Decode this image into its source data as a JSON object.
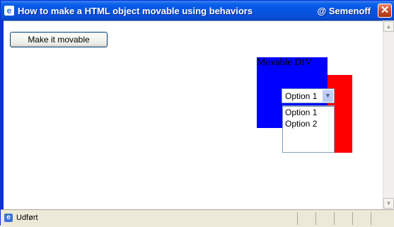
{
  "window": {
    "title": "How to make a HTML object movable using behaviors",
    "title_right": "@ Semenoff",
    "app_icon": "ie-icon",
    "close_symbol": "✕"
  },
  "page": {
    "make_button_label": "Make it movable",
    "movable_div_label": "Movable DIV",
    "select": {
      "selected": "Option 1",
      "options": [
        "Option 1",
        "Option 2"
      ]
    }
  },
  "statusbar": {
    "text": "Udført"
  },
  "colors": {
    "blue_div": "#0000ff",
    "red_div": "#ff0000",
    "titlebar": "#0554e3"
  }
}
